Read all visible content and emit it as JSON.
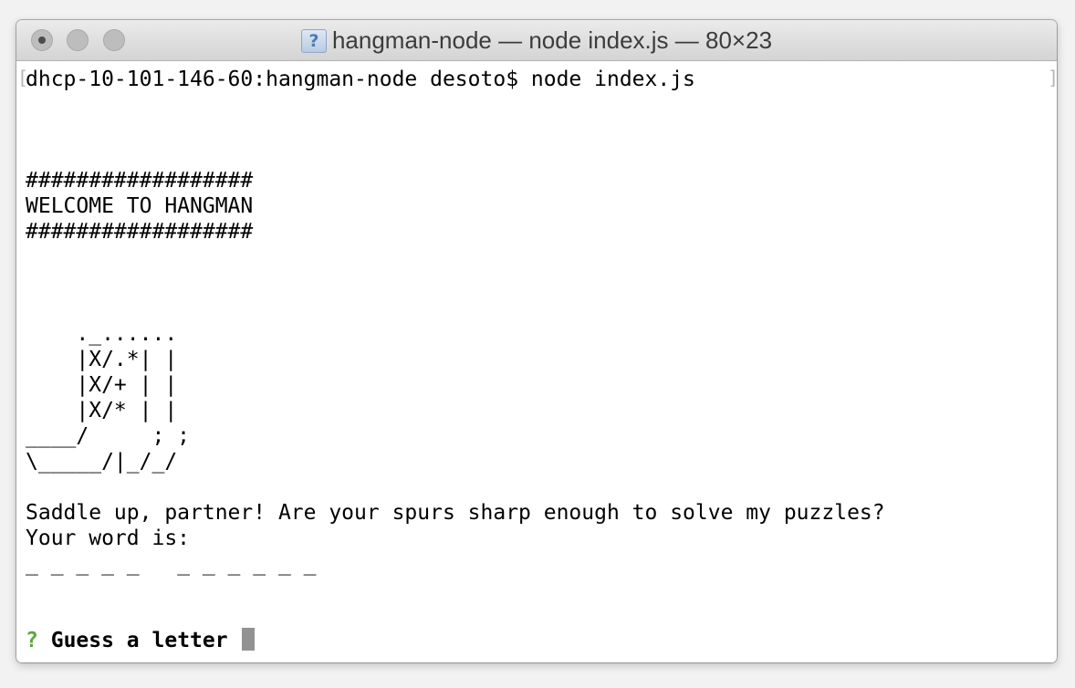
{
  "window": {
    "title": "hangman-node — node index.js — 80×23",
    "title_icon": "question-document-icon",
    "title_icon_glyph": "?"
  },
  "terminal": {
    "command_line": "dhcp-10-101-146-60:hangman-node desoto$ node index.js",
    "banner_top": "##################",
    "banner_text": "WELCOME TO HANGMAN",
    "banner_bottom": "##################",
    "art": [
      "    ._......",
      "    |X/.*| |",
      "    |X/+ | |",
      "    |X/* | |",
      "____/     ; ;",
      "\\_____/|_/_/"
    ],
    "greeting": "Saddle up, partner! Are your spurs sharp enough to solve my puzzles?",
    "word_label": "Your word is:",
    "word_blanks": "_ _ _ _ _   _ _ _ _ _ _",
    "prompt_mark": "?",
    "prompt_label": "Guess a letter"
  },
  "colors": {
    "prompt_mark": "#59a83a",
    "cursor": "#929292",
    "background": "#ffffff"
  }
}
